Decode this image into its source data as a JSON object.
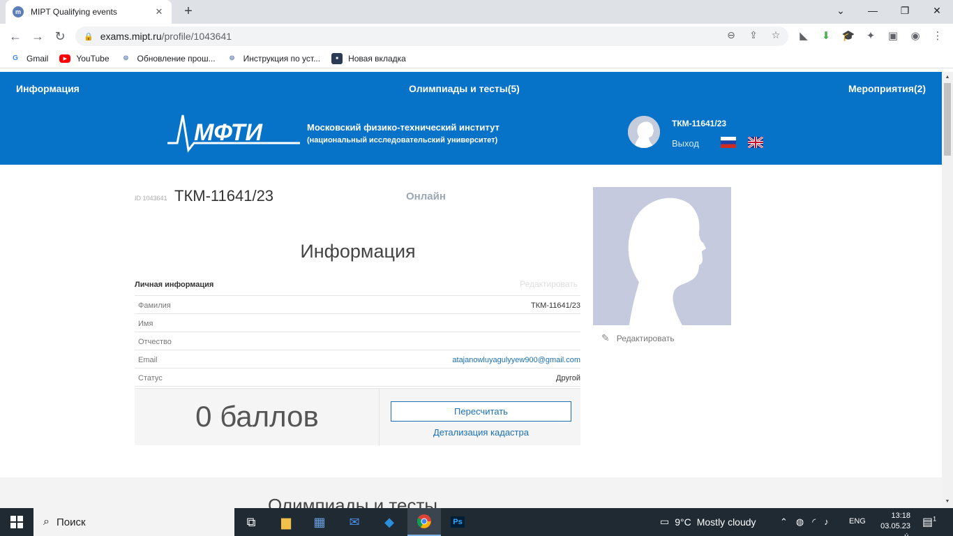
{
  "browser": {
    "tab_title": "MIPT Qualifying events",
    "url_host": "exams.mipt.ru",
    "url_path": "/profile/1043641",
    "bookmarks": [
      {
        "label": "Gmail",
        "icon": "google-icon"
      },
      {
        "label": "YouTube",
        "icon": "youtube-icon"
      },
      {
        "label": "Обновление прош...",
        "icon": "globe-icon"
      },
      {
        "label": "Инструкция по уст...",
        "icon": "globe-icon"
      },
      {
        "label": "Новая вкладка",
        "icon": "tab-icon"
      }
    ]
  },
  "site": {
    "nav": {
      "info": "Информация",
      "olympiads": "Олимпиады и тесты(5)",
      "events": "Мероприятия(2)"
    },
    "logo_text": "МФТИ",
    "institute_name": "Московский физико-технический институт",
    "institute_sub": "(национальный исследовательский университет)",
    "user_login": "ТКМ-11641/23",
    "logout": "Выход"
  },
  "profile": {
    "id_label": "ID 1043641",
    "name": "ТКМ-11641/23",
    "status": "Онлайн",
    "section_title": "Информация",
    "personal_info_label": "Личная информация",
    "edit_label": "Редактировать",
    "fields": [
      {
        "label": "Фамилия",
        "value": "ТКМ-11641/23"
      },
      {
        "label": "Имя",
        "value": ""
      },
      {
        "label": "Отчество",
        "value": ""
      },
      {
        "label": "Email",
        "value": "atajanowluyagulyyew900@gmail.com"
      },
      {
        "label": "Статус",
        "value": "Другой"
      }
    ],
    "score": "0 баллов",
    "recalc_button": "Пересчитать",
    "details_link": "Детализация кадастра",
    "photo_edit": "Редактировать",
    "next_section_title": "Олимпиады и тесты"
  },
  "taskbar": {
    "search_placeholder": "Поиск",
    "weather_temp": "9°C",
    "weather_desc": "Mostly cloudy",
    "language": "ENG",
    "time": "13:18",
    "date": "03.05.23 ý.",
    "notification_count": "1"
  },
  "colors": {
    "header_blue": "#0673c8",
    "link_blue": "#1a6fb5",
    "photo_bg": "#c5cadf"
  }
}
